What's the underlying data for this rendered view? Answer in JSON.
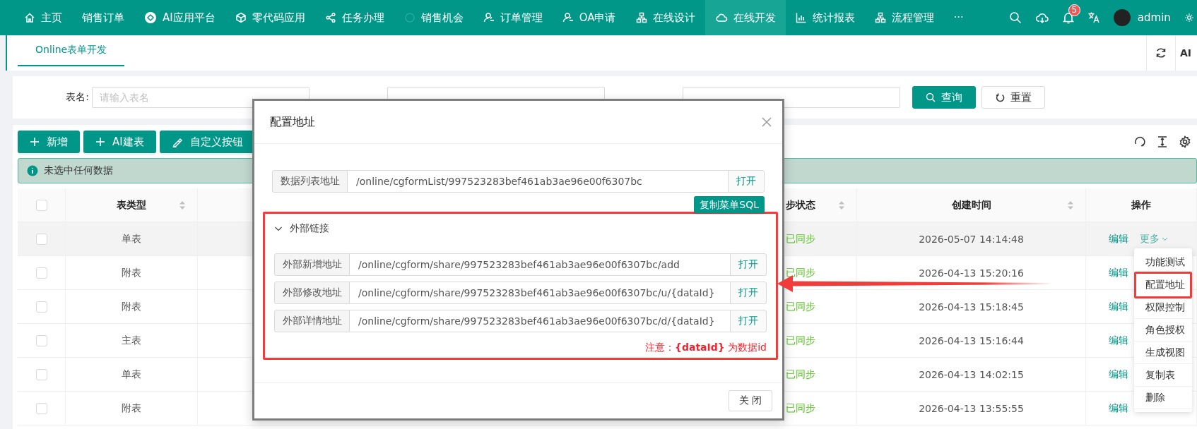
{
  "nav": {
    "items": [
      {
        "label": "主页",
        "selected": false
      },
      {
        "label": "销售订单",
        "selected": false
      },
      {
        "label": "AI应用平台",
        "selected": false
      },
      {
        "label": "零代码应用",
        "selected": false
      },
      {
        "label": "任务办理",
        "selected": false
      },
      {
        "label": "销售机会",
        "selected": false
      },
      {
        "label": "订单管理",
        "selected": false
      },
      {
        "label": "OA申请",
        "selected": false
      },
      {
        "label": "在线设计",
        "selected": false
      },
      {
        "label": "在线开发",
        "selected": true
      },
      {
        "label": "统计报表",
        "selected": false
      },
      {
        "label": "流程管理",
        "selected": false
      },
      {
        "label": "···",
        "selected": false
      }
    ],
    "badge": "5",
    "user": "admin"
  },
  "tabs": [
    {
      "label": "Online表单开发",
      "selected": true
    }
  ],
  "tab_tools": {
    "label": "AI"
  },
  "search": {
    "fields": [
      {
        "label": "表名:",
        "placeholder": "请输入表名"
      }
    ],
    "buttons": [
      {
        "label": "查询",
        "kind": "primary"
      },
      {
        "label": "重置",
        "kind": "default"
      }
    ]
  },
  "toolbar": {
    "buttons": [
      {
        "label": "新增"
      },
      {
        "label": "AI建表"
      },
      {
        "label": "自定义按钮"
      }
    ]
  },
  "alert": "未选中任何数据",
  "table": {
    "all_checked": false,
    "columns": [
      "表类型",
      "步状态",
      "创建时间",
      "操作"
    ],
    "rows": [
      {
        "type": "单表",
        "sync": "已同步",
        "created": "2026-05-07 14:14:48",
        "actions": [
          "编辑",
          "更多"
        ],
        "checked": false,
        "highlighted": true
      },
      {
        "type": "附表",
        "sync": "已同步",
        "created": "2026-04-13 15:20:16",
        "actions": [
          "编辑"
        ],
        "checked": false,
        "highlighted": false
      },
      {
        "type": "附表",
        "sync": "已同步",
        "created": "2026-04-13 15:18:45",
        "actions": [
          "编辑"
        ],
        "checked": false,
        "highlighted": false
      },
      {
        "type": "主表",
        "sync": "已同步",
        "created": "2026-04-13 15:16:44",
        "actions": [
          "编辑"
        ],
        "checked": false,
        "highlighted": false
      },
      {
        "type": "单表",
        "sync": "已同步",
        "created": "2026-04-13 14:02:15",
        "actions": [
          "编辑"
        ],
        "checked": false,
        "highlighted": false
      },
      {
        "type": "附表",
        "sync": "已同步",
        "created": "2026-04-13 13:55:55",
        "actions": [
          "编辑"
        ],
        "checked": false,
        "highlighted": false
      }
    ]
  },
  "menu": {
    "items": [
      {
        "label": "功能测试",
        "annotated": false
      },
      {
        "label": "配置地址",
        "annotated": true
      },
      {
        "label": "权限控制",
        "annotated": false
      },
      {
        "label": "角色授权",
        "annotated": false
      },
      {
        "label": "生成视图",
        "annotated": false
      },
      {
        "label": "复制表",
        "annotated": false
      },
      {
        "label": "删除",
        "annotated": false
      }
    ]
  },
  "dialog": {
    "title": "配置地址",
    "list_address": {
      "label": "数据列表地址",
      "value": "/online/cgformList/997523283bef461ab3ae96e00f6307bc",
      "action": "打开"
    },
    "copy_button": "复制菜单SQL",
    "section": {
      "title": "外部链接",
      "expanded": true,
      "annotated": true,
      "rows": [
        {
          "label": "外部新增地址",
          "value": "/online/cgform/share/997523283bef461ab3ae96e00f6307bc/add",
          "action": "打开"
        },
        {
          "label": "外部修改地址",
          "value": "/online/cgform/share/997523283bef461ab3ae96e00f6307bc/u/{dataId}",
          "action": "打开"
        },
        {
          "label": "外部详情地址",
          "value": "/online/cgform/share/997523283bef461ab3ae96e00f6307bc/d/{dataId}",
          "action": "打开"
        }
      ],
      "note": "注意：**{dataId}** 为数据id"
    },
    "close": "关 闭"
  }
}
